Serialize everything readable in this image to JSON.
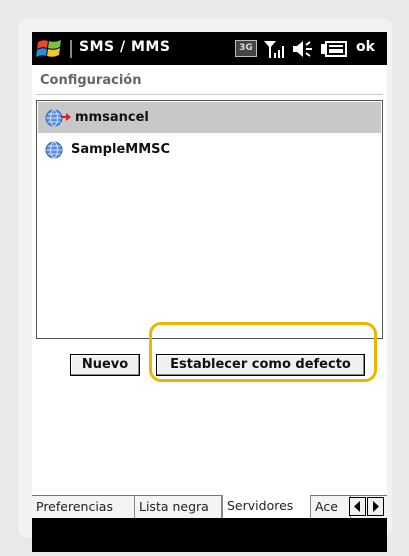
{
  "titlebar": {
    "app_title": "SMS / MMS",
    "network_badge": "3G",
    "ok_label": "ok",
    "icons": [
      "windows-logo-icon",
      "signal-icon",
      "volume-icon",
      "battery-icon"
    ]
  },
  "header": {
    "title": "Configuración"
  },
  "servers": {
    "items": [
      {
        "label": "mmsancel",
        "selected": true,
        "icon": "globe-default-icon"
      },
      {
        "label": "SampleMMSC",
        "selected": false,
        "icon": "globe-icon"
      }
    ]
  },
  "buttons": {
    "new_label": "Nuevo",
    "set_default_label": "Establecer como defecto"
  },
  "tabs": [
    {
      "label": "Preferencias",
      "active": false
    },
    {
      "label": "Lista negra",
      "active": false
    },
    {
      "label": "Servidores",
      "active": true
    },
    {
      "label": "Ace",
      "active": false
    }
  ],
  "colors": {
    "highlight": "#f0b400",
    "selection": "#c8c8c8",
    "titlebar": "#000000"
  }
}
